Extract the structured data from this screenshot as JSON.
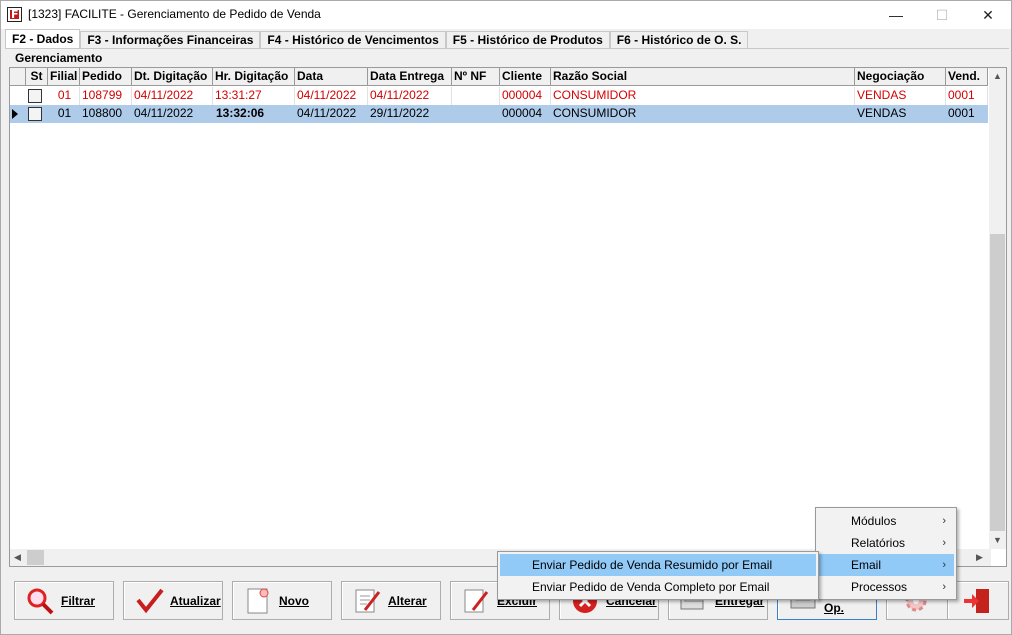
{
  "window": {
    "title": "[1323] FACILITE - Gerenciamento de Pedido de Venda",
    "app_icon_letter": "F",
    "minimize": "—",
    "maximize": "☐",
    "close": "✕"
  },
  "tabs": [
    {
      "label": "F2 - Dados"
    },
    {
      "label": "F3 - Informações Financeiras"
    },
    {
      "label": "F4 - Histórico de Vencimentos"
    },
    {
      "label": "F5 - Histórico de Produtos"
    },
    {
      "label": "F6 - Histórico de O. S."
    }
  ],
  "group": {
    "label": "Gerenciamento"
  },
  "grid": {
    "headers": [
      "St",
      "Filial",
      "Pedido",
      "Dt. Digitação",
      "Hr. Digitação",
      "Data",
      "Data Entrega",
      "Nº NF",
      "Cliente",
      "Razão Social",
      "Negociação",
      "Vend."
    ],
    "rows": [
      {
        "filial": "01",
        "pedido": "108799",
        "dt_digitacao": "04/11/2022",
        "hr_digitacao": "13:31:27",
        "data": "04/11/2022",
        "data_entrega": "04/11/2022",
        "nf": "",
        "cliente": "000004",
        "razao": "CONSUMIDOR",
        "negociacao": "VENDAS",
        "vend": "0001"
      },
      {
        "filial": "01",
        "pedido": "108800",
        "dt_digitacao": "04/11/2022",
        "hr_digitacao": "13:32:06",
        "data": "04/11/2022",
        "data_entrega": "29/11/2022",
        "nf": "",
        "cliente": "000004",
        "razao": "CONSUMIDOR",
        "negociacao": "VENDAS",
        "vend": "0001"
      }
    ]
  },
  "buttons": {
    "filtrar": "Filtrar",
    "atualizar": "Atualizar",
    "novo": "Novo",
    "alterar": "Alterar",
    "excluir": "Excluir",
    "cancelar": "Cancelar",
    "entregar": "Entregar",
    "outros": "Outros Op."
  },
  "menu": {
    "items": [
      "Módulos",
      "Relatórios",
      "Email",
      "Processos"
    ],
    "submenu": [
      "Enviar Pedido de Venda Resumido por Email",
      "Enviar Pedido de Venda Completo por Email"
    ]
  },
  "colors": {
    "accent_red": "#d40000",
    "selection": "#aecbea",
    "menu_highlight": "#91c9f7"
  }
}
